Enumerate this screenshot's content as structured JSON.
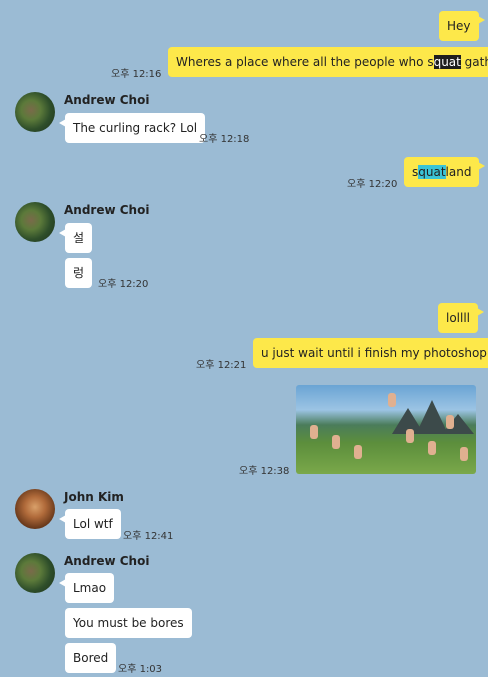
{
  "messages": {
    "m1": {
      "text": "Hey"
    },
    "m2": {
      "pre": "Wheres a place where all the people who s",
      "hl": "quat",
      "post": " gather",
      "time": "오후 12:16"
    },
    "m3": {
      "sender": "Andrew Choi",
      "text": "The curling rack? Lol",
      "time": "오후 12:18"
    },
    "m4": {
      "pre": "s",
      "hl": "quat",
      "post": "land",
      "time": "오후 12:20"
    },
    "m5": {
      "sender": "Andrew Choi",
      "text1": "설",
      "text2": "렁",
      "time": "오후 12:20"
    },
    "m6": {
      "text": "lollll"
    },
    "m7": {
      "text": "u just wait until i finish my photoshop",
      "time": "오후 12:21"
    },
    "m8": {
      "time": "오후 12:38"
    },
    "m9": {
      "sender": "John Kim",
      "text": "Lol wtf",
      "time": "오후 12:41"
    },
    "m10": {
      "sender": "Andrew Choi",
      "text1": "Lmao",
      "text2": "You must be bores",
      "text3": "Bored",
      "time": "오후 1:03"
    }
  },
  "colors": {
    "background": "#9bbbd4",
    "my_bubble": "#fde84a",
    "their_bubble": "#ffffff"
  }
}
